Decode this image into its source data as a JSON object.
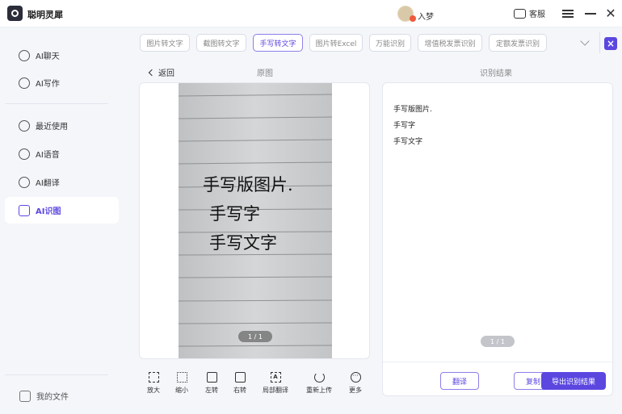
{
  "app": {
    "name": "聪明灵犀"
  },
  "user": {
    "name": "入梦"
  },
  "header": {
    "service_label": "客服"
  },
  "sidebar": {
    "items": [
      {
        "label": "AI聊天",
        "icon": "chat-icon"
      },
      {
        "label": "AI写作",
        "icon": "pen-icon"
      },
      {
        "label": "最近使用",
        "icon": "clock-icon"
      },
      {
        "label": "AI语音",
        "icon": "voice-icon"
      },
      {
        "label": "AI翻译",
        "icon": "translate-icon"
      },
      {
        "label": "AI识图",
        "icon": "scan-icon",
        "active": true
      }
    ],
    "my_files": "我的文件"
  },
  "tabs": [
    {
      "label": "图片转文字"
    },
    {
      "label": "截图转文字"
    },
    {
      "label": "手写转文字",
      "active": true
    },
    {
      "label": "图片转Excel"
    },
    {
      "label": "万能识别"
    },
    {
      "label": "增值税发票识别"
    },
    {
      "label": "定额发票识别"
    }
  ],
  "main": {
    "back_label": "返回",
    "original_label": "原图",
    "result_label": "识别结果"
  },
  "image": {
    "handwriting": [
      "手写版图片.",
      "手写字",
      "手写文字"
    ],
    "page_indicator": "1 / 1"
  },
  "result": {
    "lines": [
      "手写版图片.",
      "手写字",
      "手写文字"
    ],
    "page_indicator": "1 / 1",
    "translate_button": "翻译",
    "copy_button": "复制",
    "export_button": "导出识别结果"
  },
  "toolbar": {
    "zoom_in": "放大",
    "zoom_out": "缩小",
    "rotate_left": "左转",
    "rotate_right": "右转",
    "local_translate": "局部翻译",
    "reupload": "重新上传",
    "more": "更多"
  },
  "colors": {
    "accent": "#5b47e0",
    "sidebar_bg": "#f4f6fa",
    "photo_bg": "#c9cbcd"
  }
}
